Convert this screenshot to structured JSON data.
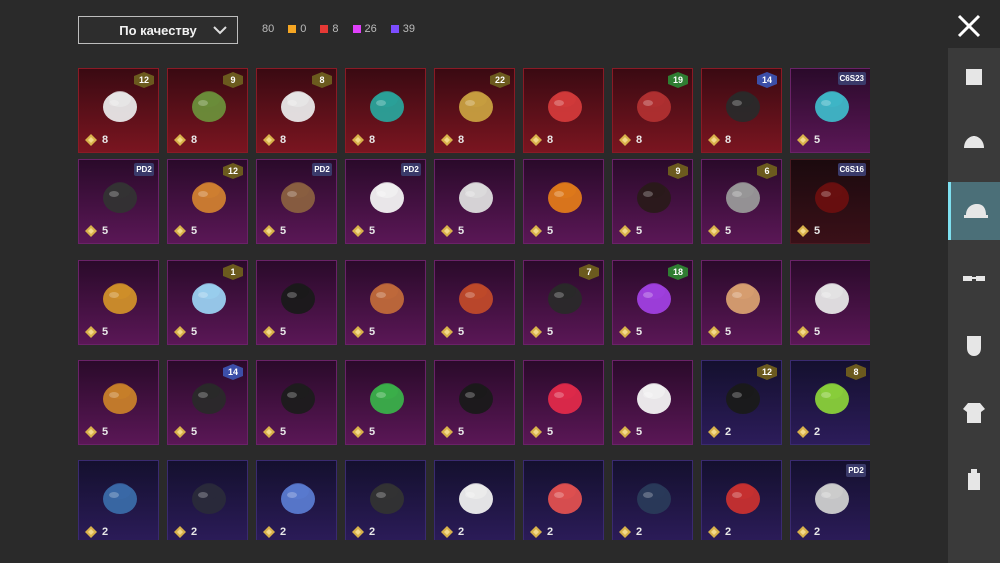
{
  "sort": {
    "label": "По качеству"
  },
  "stats": {
    "total": "80",
    "items": [
      {
        "color": "#f5a623",
        "value": "0"
      },
      {
        "color": "#e53935",
        "value": "8"
      },
      {
        "color": "#e040fb",
        "value": "26"
      },
      {
        "color": "#7c4dff",
        "value": "39"
      }
    ]
  },
  "cards": [
    {
      "color": "red",
      "art": "wig",
      "badge": "12",
      "count": "8"
    },
    {
      "color": "red",
      "art": "zombie",
      "badge": "9",
      "count": "8"
    },
    {
      "color": "red",
      "art": "wig",
      "badge": "8",
      "count": "8"
    },
    {
      "color": "red",
      "art": "helm-green",
      "badge": "",
      "count": "8"
    },
    {
      "color": "red",
      "art": "helm-gold",
      "badge": "22",
      "count": "8"
    },
    {
      "color": "red",
      "art": "mask-red",
      "badge": "",
      "count": "8"
    },
    {
      "color": "red",
      "art": "demon",
      "badge": "19",
      "count": "8"
    },
    {
      "color": "red",
      "art": "cap-dark",
      "badge": "14",
      "count": "8"
    },
    {
      "color": "pink",
      "art": "headphones",
      "badge": "C6S23",
      "count": "5"
    },
    {
      "color": "pink",
      "art": "cap-red",
      "badge": "PD2",
      "count": "5"
    },
    {
      "color": "pink",
      "art": "hair-orange",
      "badge": "12",
      "count": "5"
    },
    {
      "color": "pink",
      "art": "bear",
      "badge": "PD2",
      "count": "5"
    },
    {
      "color": "pink",
      "art": "panda",
      "badge": "PD2",
      "count": "5"
    },
    {
      "color": "pink",
      "art": "ghost",
      "badge": "",
      "count": "5"
    },
    {
      "color": "pink",
      "art": "pumpkin",
      "badge": "",
      "count": "5"
    },
    {
      "color": "pink",
      "art": "hair-dark",
      "badge": "9",
      "count": "5"
    },
    {
      "color": "pink",
      "art": "helm-mask",
      "badge": "6",
      "count": "5"
    },
    {
      "color": "dark",
      "art": "hood",
      "badge": "C6S16",
      "count": "5"
    },
    {
      "color": "pink",
      "art": "potato",
      "badge": "",
      "count": "5"
    },
    {
      "color": "pink",
      "art": "hair-blue",
      "badge": "1",
      "count": "5"
    },
    {
      "color": "pink",
      "art": "dreads",
      "badge": "",
      "count": "5"
    },
    {
      "color": "pink",
      "art": "horns",
      "badge": "",
      "count": "5"
    },
    {
      "color": "pink",
      "art": "firehat",
      "badge": "",
      "count": "5"
    },
    {
      "color": "pink",
      "art": "cap-officer",
      "badge": "7",
      "count": "5"
    },
    {
      "color": "pink",
      "art": "party",
      "badge": "18",
      "count": "5"
    },
    {
      "color": "pink",
      "art": "sack",
      "badge": "",
      "count": "5"
    },
    {
      "color": "pink",
      "art": "dreads-white",
      "badge": "",
      "count": "5"
    },
    {
      "color": "pink",
      "art": "robot",
      "badge": "",
      "count": "5"
    },
    {
      "color": "pink",
      "art": "cap-officer",
      "badge": "14",
      "count": "5"
    },
    {
      "color": "pink",
      "art": "hood-dark",
      "badge": "",
      "count": "5"
    },
    {
      "color": "pink",
      "art": "frog",
      "badge": "",
      "count": "5"
    },
    {
      "color": "pink",
      "art": "tophat",
      "badge": "",
      "count": "5"
    },
    {
      "color": "pink",
      "art": "small-horns",
      "badge": "",
      "count": "5"
    },
    {
      "color": "pink",
      "art": "sunhat",
      "badge": "",
      "count": "5"
    },
    {
      "color": "purple",
      "art": "bunny",
      "badge": "12",
      "count": "2"
    },
    {
      "color": "purple",
      "art": "skull-green",
      "badge": "8",
      "count": "2"
    },
    {
      "color": "purple",
      "art": "cap-blue",
      "badge": "",
      "count": "2"
    },
    {
      "color": "purple",
      "art": "gasmask",
      "badge": "",
      "count": "2"
    },
    {
      "color": "purple",
      "art": "cap-pattern",
      "badge": "",
      "count": "2"
    },
    {
      "color": "purple",
      "art": "beanie",
      "badge": "",
      "count": "2"
    },
    {
      "color": "purple",
      "art": "sunhat-white",
      "badge": "",
      "count": "2"
    },
    {
      "color": "purple",
      "art": "ears",
      "badge": "",
      "count": "2"
    },
    {
      "color": "purple",
      "art": "beanie-blue",
      "badge": "",
      "count": "2"
    },
    {
      "color": "purple",
      "art": "cap-redgold",
      "badge": "",
      "count": "2"
    },
    {
      "color": "purple",
      "art": "wig-grey",
      "badge": "PD2",
      "count": "2"
    }
  ],
  "sidebar": {
    "tabs": [
      {
        "name": "outfit"
      },
      {
        "name": "helmet"
      },
      {
        "name": "hat"
      },
      {
        "name": "glasses"
      },
      {
        "name": "mask"
      },
      {
        "name": "jacket"
      },
      {
        "name": "backpack"
      }
    ],
    "active_index": 2
  }
}
